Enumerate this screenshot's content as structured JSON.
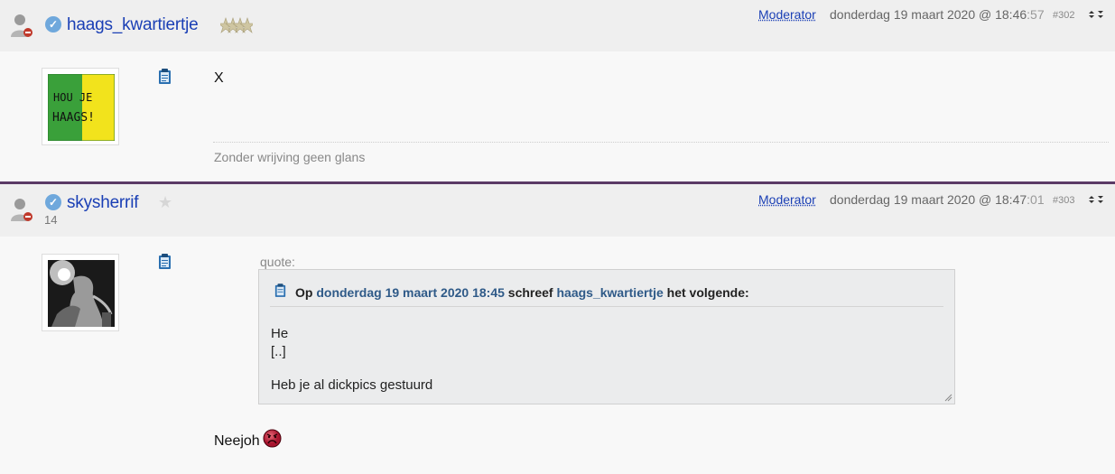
{
  "posts": [
    {
      "username": "haags_kwartiertje",
      "role_link": "Moderator",
      "date_main": "donderdag 19 maart 2020 @ 18:46",
      "date_sec": ":57",
      "post_number": "#302",
      "body": "X",
      "signature": "Zonder wrijving geen glans",
      "avatar_text": "HOU JE HAAGS!"
    },
    {
      "username": "skysherrif",
      "post_count": "14",
      "role_link": "Moderator",
      "date_main": "donderdag 19 maart 2020 @ 18:47",
      "date_sec": ":01",
      "post_number": "#303",
      "quote": {
        "label": "quote:",
        "head_op": "Op",
        "head_date": "donderdag 19 maart 2020 18:45",
        "head_mid": "schreef",
        "head_user": "haags_kwartiertje",
        "head_end": "het volgende:",
        "lines": [
          "He",
          "[..]",
          "Heb je al dickpics gestuurd"
        ]
      },
      "reply": "Neejoh"
    }
  ],
  "icons": [
    "user-offline-icon",
    "verified-icon",
    "rank-stars-icon",
    "star-icon",
    "clipboard-icon",
    "sort-arrows-icon",
    "angry-smiley-icon"
  ],
  "colors": {
    "username": "#1a3fb5",
    "divider": "#5b3a66",
    "header_bg": "#efefef",
    "page_bg": "#f8f8f8",
    "quote_bg": "#ebeced"
  }
}
